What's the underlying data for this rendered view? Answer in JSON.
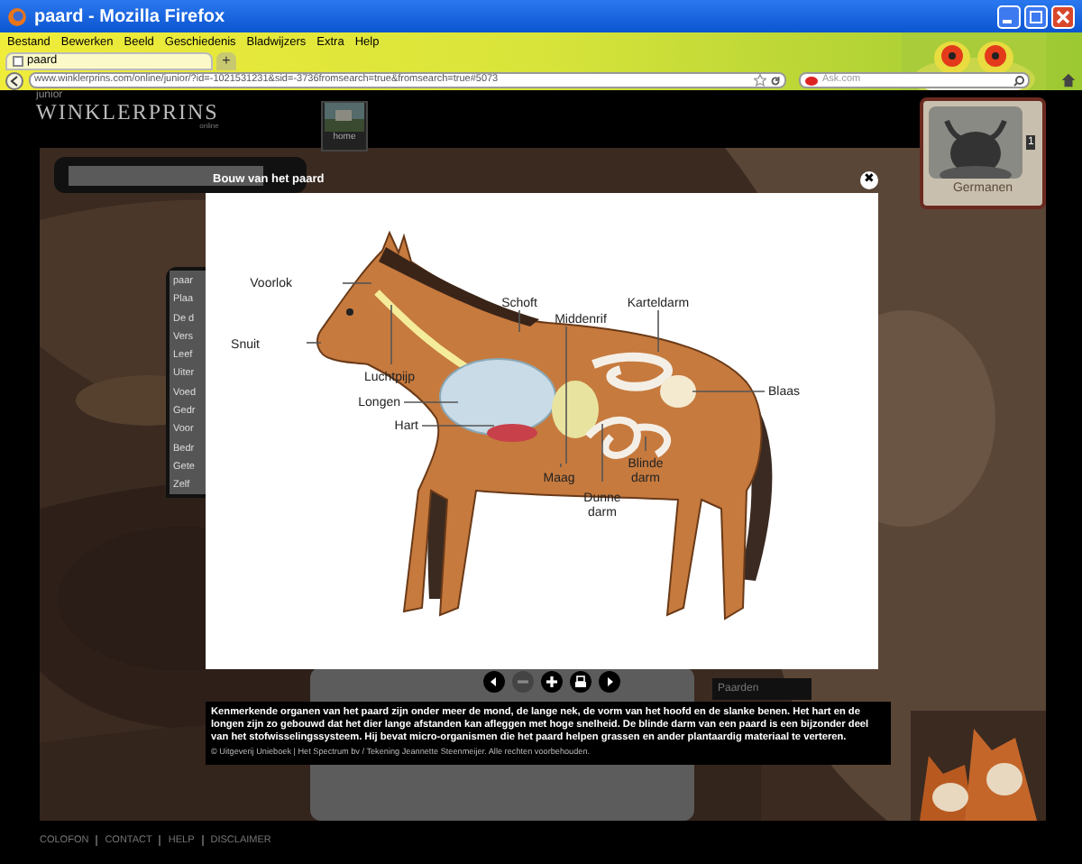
{
  "window": {
    "title": "paard - Mozilla Firefox"
  },
  "menu": [
    "Bestand",
    "Bewerken",
    "Beeld",
    "Geschiedenis",
    "Bladwijzers",
    "Extra",
    "Help"
  ],
  "tabs": [
    {
      "label": "paard",
      "selected": true
    }
  ],
  "new_tab": "+",
  "address_bar": {
    "url": "www.winklerprins.com/online/junior/?id=-1021531231&sid=-3736fromsearch=true&fromsearch=true#5073"
  },
  "search": {
    "placeholder": "Ask.com"
  },
  "page": {
    "logo": {
      "small": "junior",
      "name": "WINKLERPRINS",
      "sub": "online"
    },
    "home_label": "home",
    "promo_label": "Germanen",
    "promo_channel": "1",
    "article_list": [
      "paar",
      "Plaa",
      "De d",
      "Vers",
      "Leef",
      "Uiter",
      "Voed",
      "Gedr",
      "Voor",
      "Bedr",
      "Gete",
      "Zelf"
    ],
    "related": "Paarden",
    "footer_links": [
      "COLOFON",
      "CONTACT",
      "HELP",
      "DISCLAIMER"
    ]
  },
  "viewer": {
    "title": "Bouw van het paard",
    "close": "✖",
    "labels": [
      "Voorlok",
      "Snuit",
      "Luchtpijp",
      "Longen",
      "Hart",
      "Schoft",
      "Middenrif",
      "Karteldarm",
      "Blaas",
      "Maag",
      "Dunne darm",
      "Blinde darm"
    ],
    "controls": [
      {
        "kind": "prev",
        "disabled": false
      },
      {
        "kind": "zoom-out",
        "disabled": true
      },
      {
        "kind": "zoom-in",
        "disabled": false
      },
      {
        "kind": "print",
        "disabled": false
      },
      {
        "kind": "next",
        "disabled": false
      }
    ],
    "caption": "Kenmerkende organen van het paard zijn onder meer de mond, de lange nek, de vorm van het hoofd en de slanke benen. Het hart en de longen zijn zo gebouwd dat het dier lange afstanden kan afleggen met hoge snelheid. De blinde darm van een paard is een bijzonder deel van het stofwisselingssysteem. Hij bevat micro-organismen die het paard helpen grassen en ander plantaardig materiaal te verteren.",
    "credit": "© Uitgeverij Unieboek | Het Spectrum bv / Tekening Jeannette Steenmeijer. Alle rechten voorbehouden."
  }
}
